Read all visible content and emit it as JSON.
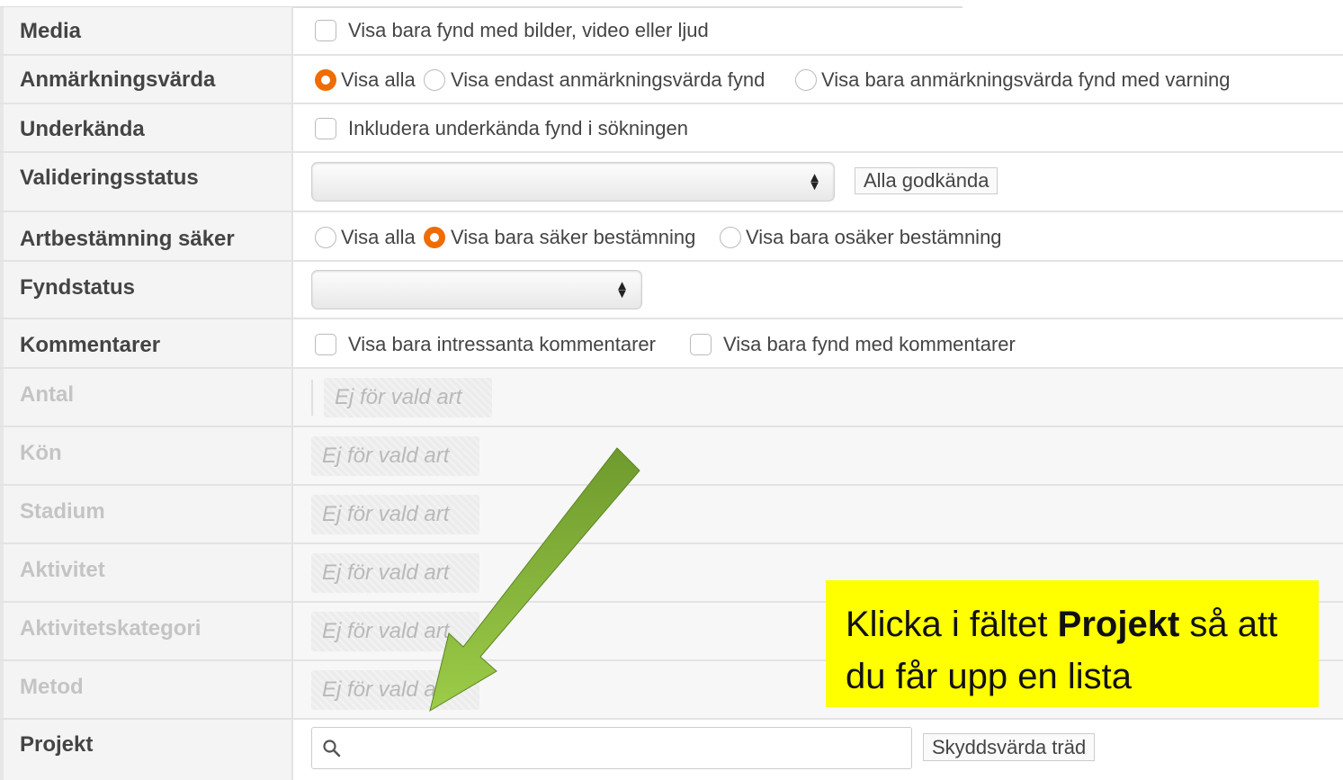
{
  "rows": {
    "media": {
      "label": "Media",
      "option": "Visa bara fynd med bilder, video eller ljud"
    },
    "anmarkningsvarda": {
      "label": "Anmärkningsvärda",
      "options": [
        "Visa alla",
        "Visa endast anmärkningsvärda fynd",
        "Visa bara anmärkningsvärda fynd med varning"
      ]
    },
    "underkanda": {
      "label": "Underkända",
      "option": "Inkludera underkända fynd i sökningen"
    },
    "valideringsstatus": {
      "label": "Valideringsstatus",
      "selected": "",
      "tag": "Alla godkända"
    },
    "artbestamning": {
      "label": "Artbestämning säker",
      "options": [
        "Visa alla",
        "Visa bara säker bestämning",
        "Visa bara osäker bestämning"
      ]
    },
    "fyndstatus": {
      "label": "Fyndstatus",
      "selected": ""
    },
    "kommentarer": {
      "label": "Kommentarer",
      "options": [
        "Visa bara intressanta kommentarer",
        "Visa bara fynd med kommentarer"
      ]
    },
    "antal": {
      "label": "Antal",
      "value": "Ej för vald art"
    },
    "kon": {
      "label": "Kön",
      "value": "Ej för vald art"
    },
    "stadium": {
      "label": "Stadium",
      "value": "Ej för vald art"
    },
    "aktivitet": {
      "label": "Aktivitet",
      "value": "Ej för vald art"
    },
    "aktivitetskategori": {
      "label": "Aktivitetskategori",
      "value": "Ej för vald art"
    },
    "metod": {
      "label": "Metod",
      "value": "Ej för vald art"
    },
    "projekt": {
      "label": "Projekt",
      "placeholder": "",
      "tag": "Skyddsvärda träd"
    }
  },
  "callout": {
    "part1": "Klicka i fältet ",
    "bold": "Projekt",
    "part2": " så att du får upp en lista"
  },
  "colors": {
    "accent": "#ef6c00",
    "callout_bg": "#ffff00",
    "arrow": "#8dc63f"
  }
}
